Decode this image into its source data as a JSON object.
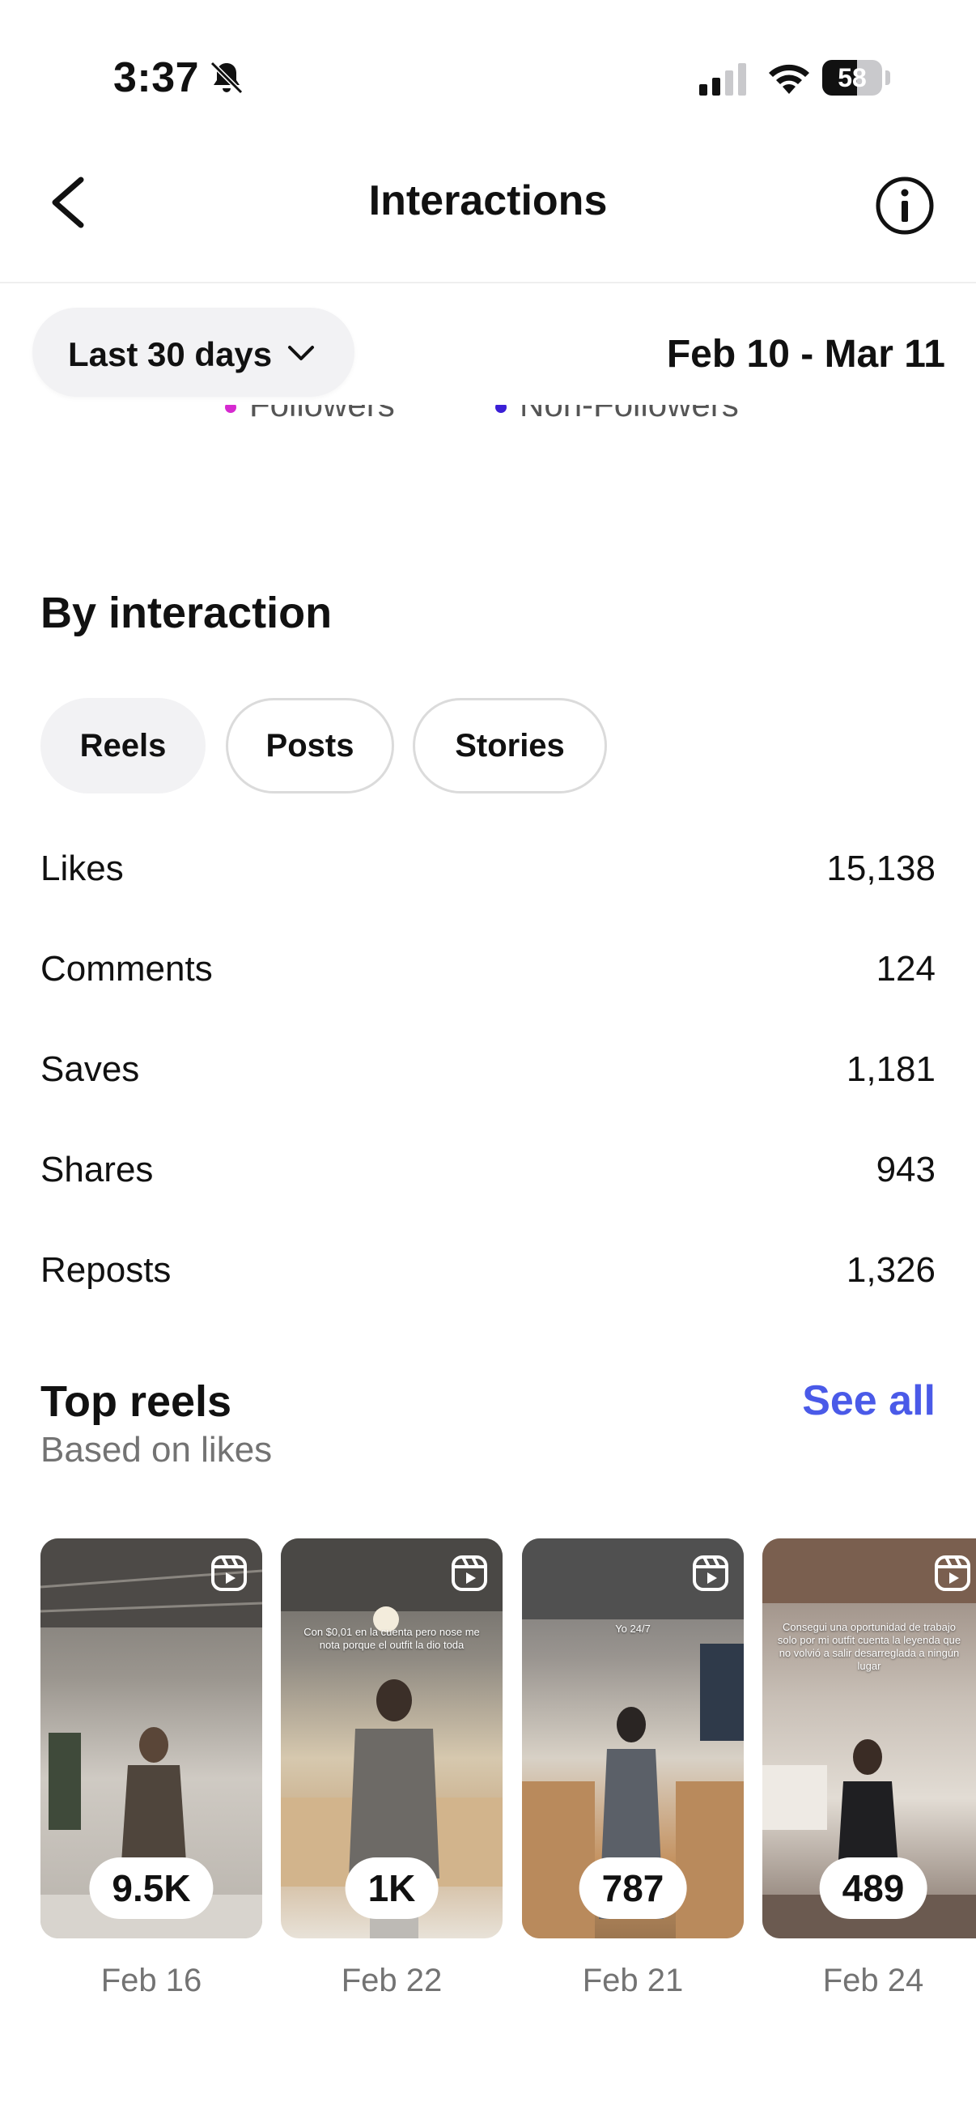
{
  "status_bar": {
    "time": "3:37",
    "battery": "58",
    "battery_level": 0.58
  },
  "header": {
    "title": "Interactions"
  },
  "range": {
    "label": "Last 30 days",
    "dates": "Feb 10 - Mar 11"
  },
  "legend": [
    {
      "label": "Followers",
      "color": "#d62ad0"
    },
    {
      "label": "Non-Followers",
      "color": "#3b1fd6"
    }
  ],
  "by_interaction": {
    "title": "By interaction",
    "chips": [
      "Reels",
      "Posts",
      "Stories"
    ],
    "metrics": [
      {
        "label": "Likes",
        "value": "15,138"
      },
      {
        "label": "Comments",
        "value": "124"
      },
      {
        "label": "Saves",
        "value": "1,181"
      },
      {
        "label": "Shares",
        "value": "943"
      },
      {
        "label": "Reposts",
        "value": "1,326"
      }
    ]
  },
  "top_reels": {
    "title": "Top reels",
    "subtitle": "Based on likes",
    "see_all": "See all",
    "items": [
      {
        "count": "9.5K",
        "date": "Feb 16",
        "caption": ""
      },
      {
        "count": "1K",
        "date": "Feb 22",
        "caption": "Con $0,01 en la cuenta pero nose me nota porque el outfit la dio toda"
      },
      {
        "count": "787",
        "date": "Feb 21",
        "caption": "Yo 24/7"
      },
      {
        "count": "489",
        "date": "Feb 24",
        "caption": "Consegui una oportunidad de trabajo solo por mi outfit cuenta la leyenda que no volvió a salir desarreglada a ningún lugar"
      }
    ]
  }
}
